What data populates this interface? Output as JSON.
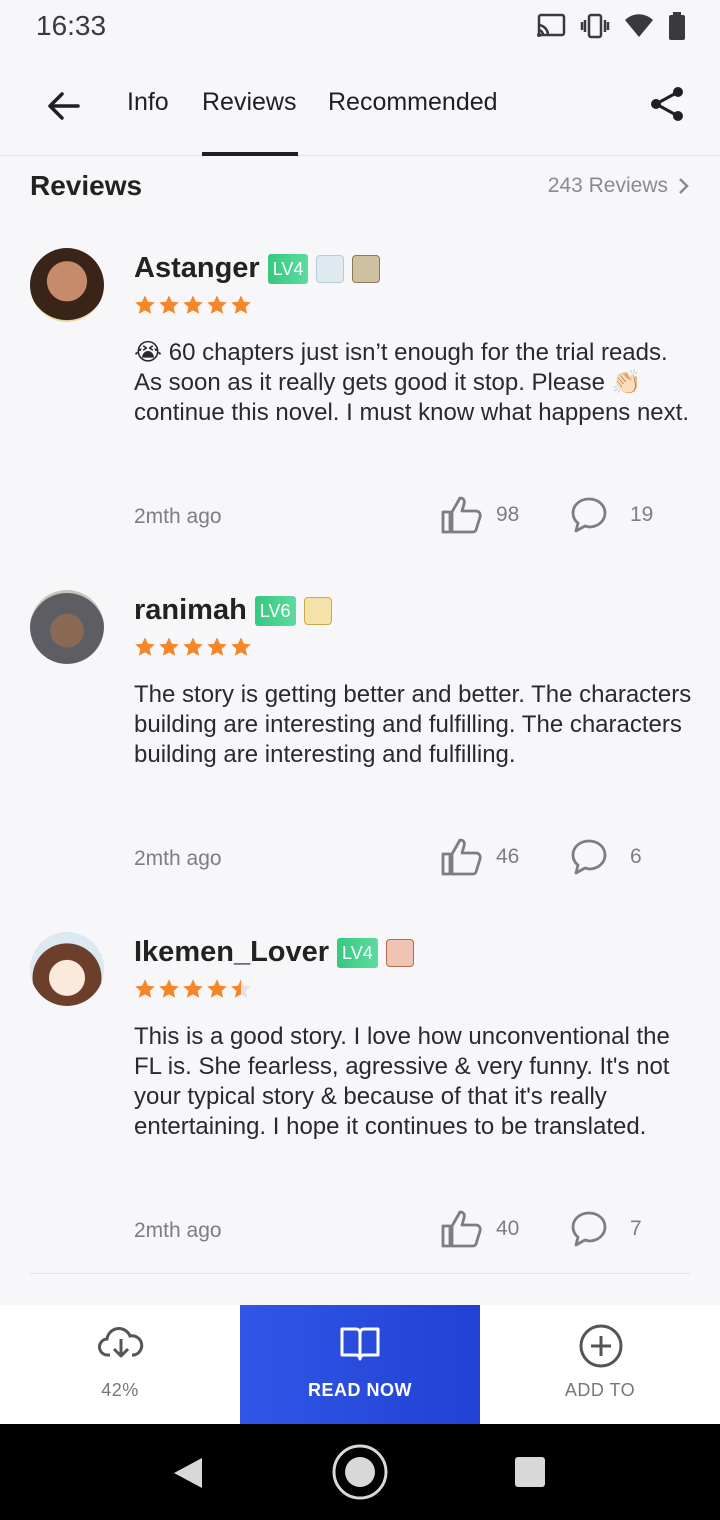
{
  "status_bar": {
    "time": "16:33",
    "icons": [
      "cast-icon",
      "vibrate-icon",
      "wifi-icon",
      "battery-icon"
    ]
  },
  "nav": {
    "tabs": [
      {
        "label": "Info",
        "active": false
      },
      {
        "label": "Reviews",
        "active": true
      },
      {
        "label": "Recommended",
        "active": false
      }
    ]
  },
  "section": {
    "title": "Reviews",
    "count_label": "243 Reviews"
  },
  "reviews": [
    {
      "username": "Astanger",
      "level": "LV4",
      "rating": 5,
      "text": "60 chapters just isn’t enough for the trial reads. As soon as it really gets good it stop. Please 👏🏻 continue this novel. I must know what happens next.",
      "leading_emoji": "😭",
      "time": "2mth ago",
      "likes": "98",
      "comments": "19"
    },
    {
      "username": "ranimah",
      "level": "LV6",
      "rating": 5,
      "text": "The story is getting better and better. The characters building are interesting and fulfilling. The characters building are interesting and fulfilling.",
      "time": "2mth ago",
      "likes": "46",
      "comments": "6"
    },
    {
      "username": "Ikemen_Lover",
      "level": "LV4",
      "rating": 4.5,
      "text": "This is a good story. I love how unconventional the FL is. She fearless, agressive & very funny. It's not your typical story & because of that it's really entertaining. I hope it continues to be translated.",
      "time": "2mth ago",
      "likes": "40",
      "comments": "7"
    }
  ],
  "actions": {
    "download_label": "42%",
    "download_progress": 0.42,
    "read_label": "READ NOW",
    "add_label": "ADD TO"
  },
  "colors": {
    "accent": "#2f54e4",
    "star": "#f5872a",
    "level_badge": "#3ecf8a"
  }
}
